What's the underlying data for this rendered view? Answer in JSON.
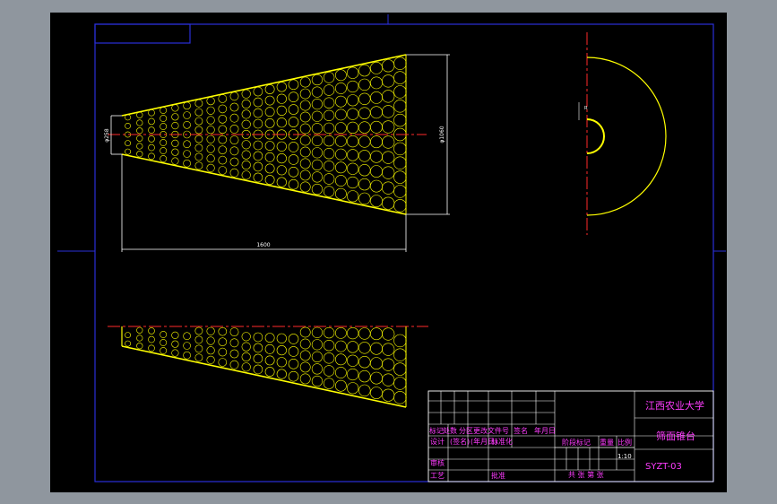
{
  "colors": {
    "background": "#000000",
    "frame": "#2a2fd8",
    "geometry": "#ffff00",
    "dimensions": "#ffffff",
    "centerline": "#ff2a2a",
    "title_block_text": "#ff3cff",
    "title_block_lines": "#ffffff"
  },
  "dimensions": {
    "small_diameter": "φ258",
    "large_diameter": "φ1060",
    "length": "1600",
    "radius": "R"
  },
  "title_block": {
    "school": "江西农业大学",
    "part_name": "筛面锥台",
    "drawing_number": "SYZT-03",
    "scale_value": "1:10",
    "row_headers": [
      "标记",
      "处数",
      "分区",
      "更改文件号",
      "签名",
      "年月日"
    ],
    "design_row": [
      "设计",
      "(签名)",
      "(年月日)",
      "标准化"
    ],
    "review": "审核",
    "process": "工艺",
    "approve": "批准",
    "stage_labels": [
      "阶段标记",
      "重量",
      "比例"
    ],
    "sheet_text": "共  张 第  张"
  }
}
